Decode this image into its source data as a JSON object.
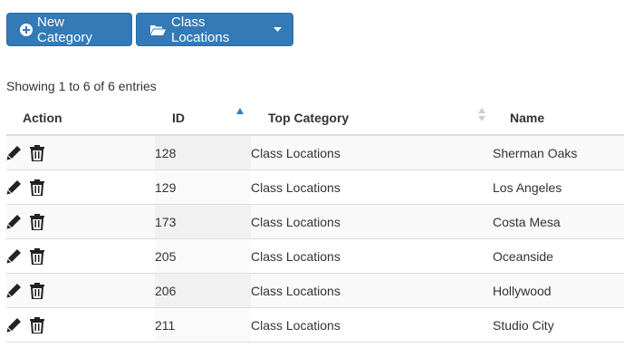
{
  "toolbar": {
    "new_category_label": "New Category",
    "class_locations_label": "Class Locations",
    "new_category_icon": "plus-circle-icon",
    "class_locations_icon": "folder-open-icon",
    "dropdown_icon": "caret-down-icon",
    "button_color": "#337ab7"
  },
  "table_info": "Showing 1 to 6 of 6 entries",
  "table": {
    "headers": {
      "action": "Action",
      "id": "ID",
      "top_category": "Top Category",
      "name": "Name"
    },
    "sort": {
      "column": "ID",
      "direction": "ascending",
      "active_color": "#337ab7"
    },
    "rows": [
      {
        "id": "128",
        "top_category": "Class Locations",
        "name": "Sherman Oaks"
      },
      {
        "id": "129",
        "top_category": "Class Locations",
        "name": "Los Angeles"
      },
      {
        "id": "173",
        "top_category": "Class Locations",
        "name": "Costa Mesa"
      },
      {
        "id": "205",
        "top_category": "Class Locations",
        "name": "Oceanside"
      },
      {
        "id": "206",
        "top_category": "Class Locations",
        "name": "Hollywood"
      },
      {
        "id": "211",
        "top_category": "Class Locations",
        "name": "Studio City"
      }
    ],
    "row_actions": [
      "pencil-icon",
      "trash-icon"
    ]
  }
}
